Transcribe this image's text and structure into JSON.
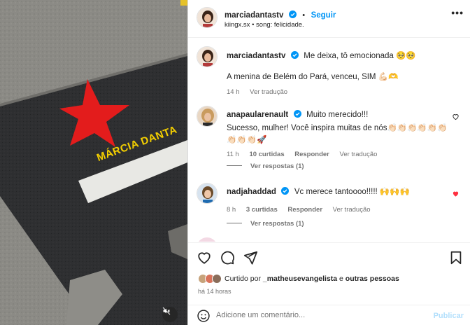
{
  "media": {
    "plaque_text": "MÁRCIA DANTA",
    "star_color": "#e31c1c",
    "plaque_text_color": "#f5d000"
  },
  "header": {
    "username": "marciadantastv",
    "follow_label": "Seguir",
    "subtitle": "kiingx.sx • song: felicidade.",
    "more_label": "•••"
  },
  "comments": [
    {
      "username": "marciadantastv",
      "text_line1": "Me deixa, tô emocionada 🥺🥺",
      "text_line2": "A menina de Belém do Pará, venceu, SIM 💪🏻🫶",
      "time": "14 h",
      "reply_label": "Ver tradução"
    },
    {
      "username": "anapaularenault",
      "text_line1": "Muito merecido!!!",
      "text_line2": "Sucesso, mulher! Você inspira muitas de nós👏🏻👏🏻👏🏻👏🏻👏🏻👏🏻",
      "text_line3": "👏🏻👏🏻👏🏻🚀",
      "time": "11 h",
      "likes": "10 curtidas",
      "reply_label": "Responder",
      "translate_label": "Ver tradução",
      "view_replies": "Ver respostas (1)"
    },
    {
      "username": "nadjahaddad",
      "text_line1": "Vc merece tantoooo!!!!! 🙌🙌🙌",
      "time": "8 h",
      "likes": "3 curtidas",
      "reply_label": "Responder",
      "translate_label": "Ver tradução",
      "view_replies": "Ver respostas (1)"
    }
  ],
  "actions": {
    "liked_prefix": "Curtido por",
    "liked_user": "_matheusevangelista",
    "liked_suffix": "e",
    "liked_others": "outras pessoas",
    "time_ago": "há 14 horas"
  },
  "comment_box": {
    "placeholder": "Adicione um comentário...",
    "publish_label": "Publicar"
  },
  "colors": {
    "accent": "#0095f6",
    "liked_heart": "#ff3040",
    "verified": "#0095f6"
  }
}
